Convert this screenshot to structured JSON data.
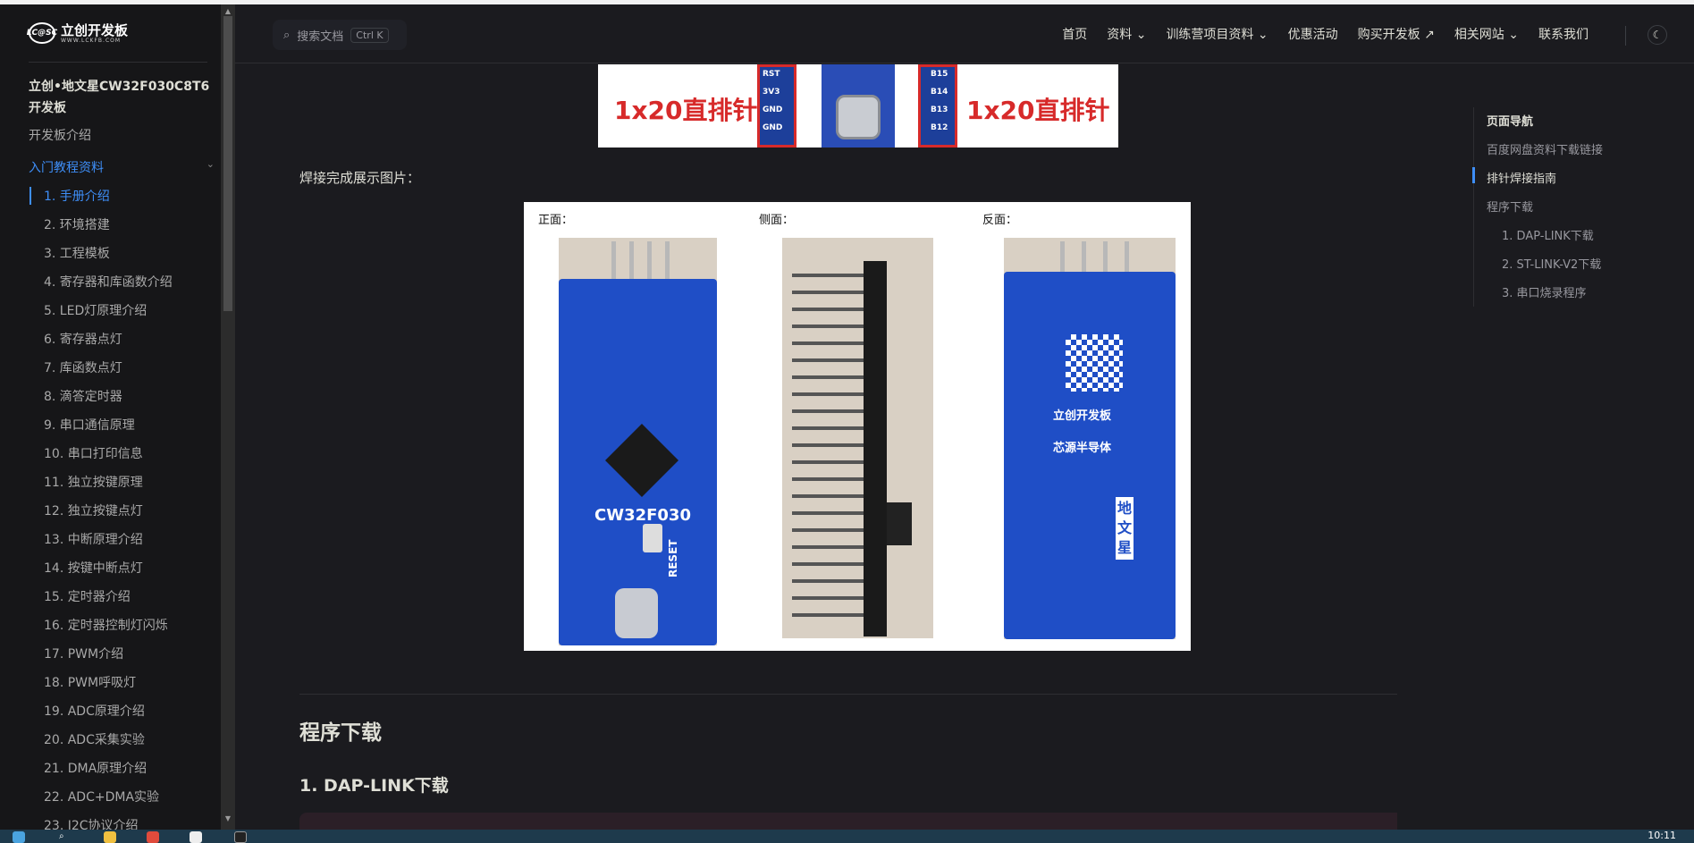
{
  "sidebar": {
    "logo_text": "立创开发板",
    "logo_sub": "WWW.LCKFB.COM",
    "logo_mark": "LC@SC",
    "title": "立创•地文星CW32F030C8T6开发板",
    "intro": "开发板介绍",
    "group_label": "入门教程资料",
    "items": [
      "1. 手册介绍",
      "2. 环境搭建",
      "3. 工程模板",
      "4. 寄存器和库函数介绍",
      "5. LED灯原理介绍",
      "6. 寄存器点灯",
      "7. 库函数点灯",
      "8. 滴答定时器",
      "9. 串口通信原理",
      "10. 串口打印信息",
      "11. 独立按键原理",
      "12. 独立按键点灯",
      "13. 中断原理介绍",
      "14. 按键中断点灯",
      "15. 定时器介绍",
      "16. 定时器控制灯闪烁",
      "17. PWM介绍",
      "18. PWM呼吸灯",
      "19. ADC原理介绍",
      "20. ADC采集实验",
      "21. DMA原理介绍",
      "22. ADC+DMA实验",
      "23. I2C协议介绍"
    ]
  },
  "nav": {
    "search_placeholder": "搜索文档",
    "search_shortcut": "Ctrl K",
    "links": [
      "首页",
      "资料 ⌄",
      "训练营项目资料 ⌄",
      "优惠活动",
      "购买开发板 ↗",
      "相关网站 ⌄",
      "联系我们"
    ],
    "theme_icon": "☾"
  },
  "content": {
    "top_image_labels": [
      "1x20直排针",
      "1x20直排针"
    ],
    "top_image_pins_left": [
      "RST",
      "3V3",
      "GND",
      "GND"
    ],
    "top_image_pins_right": [
      "B15",
      "B14",
      "B13",
      "B12"
    ],
    "caption": "焊接完成展示图片：",
    "photo_labels": [
      "正面：",
      "侧面：",
      "反面："
    ],
    "front_chip_text": "CW32F030",
    "back_logo_text": "立创开发板",
    "back_brand_text": "芯源半导体",
    "back_name_text": "地文星",
    "reset_text": "RESET",
    "heading_program": "程序下载",
    "heading_daplink": "1. DAP-LINK下载"
  },
  "outline": {
    "title": "页面导航",
    "items": [
      {
        "label": "百度网盘资料下载链接",
        "active": false
      },
      {
        "label": "排针焊接指南",
        "active": true
      },
      {
        "label": "程序下载",
        "active": false
      },
      {
        "label": "1. DAP-LINK下载",
        "active": false
      },
      {
        "label": "2. ST-LINK-V2下载",
        "active": false
      },
      {
        "label": "3. 串口烧录程序",
        "active": false
      }
    ]
  },
  "taskbar": {
    "time": "10:11"
  },
  "colors": {
    "accent": "#3e8ef7",
    "background": "#1b1b1f",
    "sidebar": "#161618",
    "pcb_blue": "#1f4ec6",
    "label_red": "#d72a2a"
  }
}
